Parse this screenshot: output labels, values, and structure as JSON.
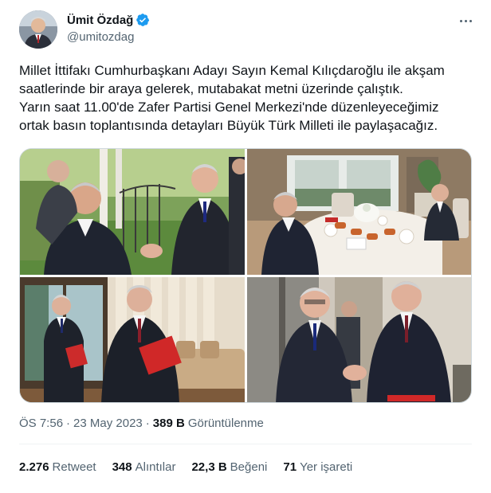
{
  "author": {
    "display_name": "Ümit Özdağ",
    "handle": "@umitozdag",
    "verified": true,
    "icons": [
      "avatar",
      "verified-badge-icon",
      "more-options-icon"
    ]
  },
  "tweet": {
    "lines": [
      "Millet İttifakı Cumhurbaşkanı Adayı Sayın Kemal Kılıçdaroğlu ile akşam",
      "saatlerinde bir araya gelerek, mutabakat metni üzerinde çalıştık.",
      "Yarın saat 11.00'de Zafer Partisi Genel Merkezi'nde düzenleyeceğimiz",
      "ortak basın toplantısında detayları Büyük Türk Milleti ile paylaşacağız."
    ]
  },
  "media": {
    "photos": [
      {
        "alt": "handshake-outdoors-photo"
      },
      {
        "alt": "dinner-table-meeting-photo"
      },
      {
        "alt": "holding-red-folders-photo"
      },
      {
        "alt": "handshake-indoors-photo"
      }
    ]
  },
  "meta": {
    "time": "ÖS 7:56",
    "separator": "·",
    "date": "23 May 2023",
    "separator2": "·",
    "views_count": "389 B",
    "views_label": "Görüntülenme"
  },
  "stats": {
    "retweets": {
      "count": "2.276",
      "label": "Retweet"
    },
    "quotes": {
      "count": "348",
      "label": "Alıntılar"
    },
    "likes": {
      "count": "22,3 B",
      "label": "Beğeni"
    },
    "bookmarks": {
      "count": "71",
      "label": "Yer işareti"
    }
  },
  "colors": {
    "text_primary": "#0f1419",
    "text_secondary": "#536471",
    "verified_blue": "#1d9bf0",
    "divider": "#eff3f4"
  }
}
